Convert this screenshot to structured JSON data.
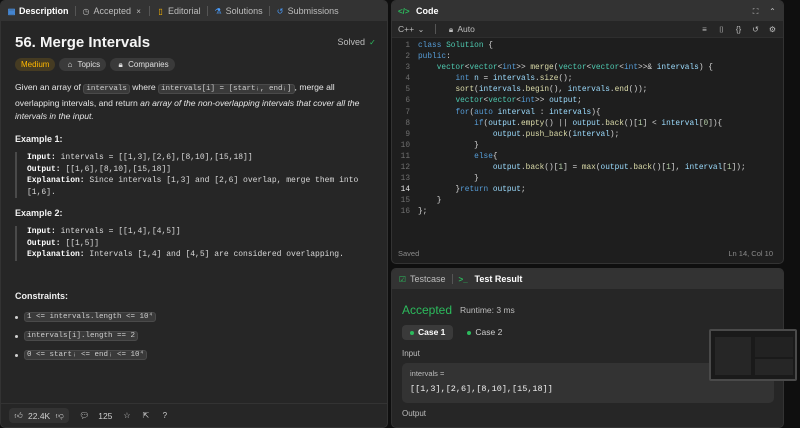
{
  "left_panel": {
    "tabs": [
      {
        "label": "Description",
        "icon": "description-icon"
      },
      {
        "label": "Accepted",
        "icon": "clock-icon"
      },
      {
        "label": "Editorial",
        "icon": "book-icon"
      },
      {
        "label": "Solutions",
        "icon": "flask-icon"
      },
      {
        "label": "Submissions",
        "icon": "history-icon"
      }
    ],
    "title": "56. Merge Intervals",
    "solved_label": "Solved",
    "difficulty": "Medium",
    "topics_label": "Topics",
    "companies_label": "Companies",
    "description": {
      "p1": "Given an array of",
      "c1": "intervals",
      "p2": "where",
      "c2": "intervals[i] = [startᵢ, endᵢ]",
      "p3": ", merge all overlapping intervals, and return",
      "em": "an array of the non-overlapping intervals that cover all the intervals in the input."
    },
    "example1": {
      "heading": "Example 1:",
      "input_label": "Input:",
      "input": "intervals = [[1,3],[2,6],[8,10],[15,18]]",
      "output_label": "Output:",
      "output": "[[1,6],[8,10],[15,18]]",
      "explanation_label": "Explanation:",
      "explanation": "Since intervals [1,3] and [2,6] overlap, merge them into [1,6]."
    },
    "example2": {
      "heading": "Example 2:",
      "input_label": "Input:",
      "input": "intervals = [[1,4],[4,5]]",
      "output_label": "Output:",
      "output": "[[1,5]]",
      "explanation_label": "Explanation:",
      "explanation": "Intervals [1,4] and [4,5] are considered overlapping."
    },
    "constraints_heading": "Constraints:",
    "constraints": [
      "1 <= intervals.length <= 10⁴",
      "intervals[i].length == 2",
      "0 <= startᵢ <= endᵢ <= 10⁴"
    ],
    "footer": {
      "likes": "22.4K",
      "comments": "125"
    }
  },
  "code_panel": {
    "tab_label": "Code",
    "language": "C++",
    "auto_label": "Auto",
    "status": "Saved",
    "cursor": "Ln 14, Col 10",
    "lines": [
      "class Solution {",
      "public:",
      "    vector<vector<int>> merge(vector<vector<int>>& intervals) {",
      "        int n = intervals.size();",
      "        sort(intervals.begin(), intervals.end());",
      "        vector<vector<int>> output;",
      "        for(auto interval : intervals){",
      "            if(output.empty() || output.back()[1] < interval[0]){",
      "                output.push_back(interval);",
      "            }",
      "            else{",
      "                output.back()[1] = max(output.back()[1], interval[1]);",
      "            }",
      "        }return output;",
      "    }",
      "};"
    ]
  },
  "test_panel": {
    "tabs": [
      {
        "label": "Testcase"
      },
      {
        "label": "Test Result"
      }
    ],
    "result": "Accepted",
    "runtime": "Runtime: 3 ms",
    "cases": [
      "Case 1",
      "Case 2"
    ],
    "input_label": "Input",
    "var_name": "intervals =",
    "var_value": "[[1,3],[2,6],[8,10],[15,18]]",
    "output_label": "Output"
  },
  "colors": {
    "accent_green": "#2cbb5d",
    "medium": "#ffb800",
    "panel": "#262626"
  }
}
